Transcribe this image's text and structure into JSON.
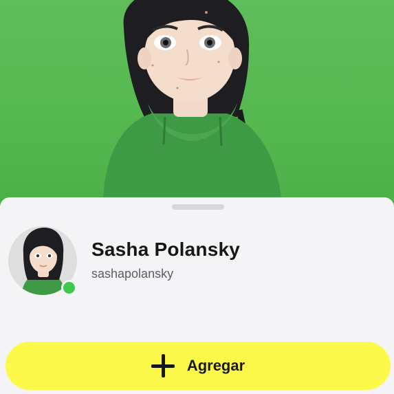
{
  "profile": {
    "display_name": "Sasha Polansky",
    "username": "sashapolansky",
    "status": "online"
  },
  "actions": {
    "add_label": "Agregar",
    "add_icon": "plus-icon"
  },
  "colors": {
    "hero_background": "#5fbd5b",
    "button_background": "#fdf94a",
    "online_indicator": "#3cc94e"
  }
}
